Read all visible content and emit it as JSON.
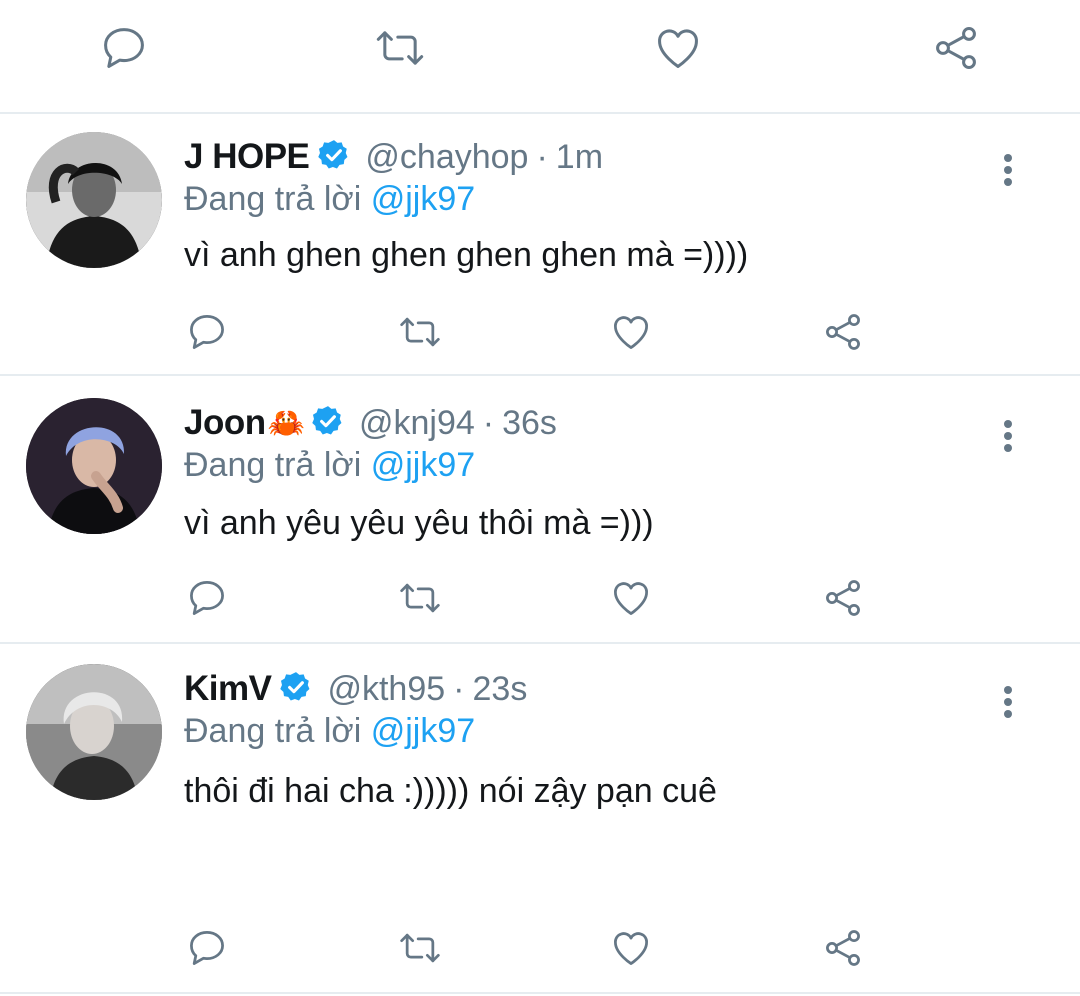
{
  "icons": {
    "reply": "reply-icon",
    "retweet": "retweet-icon",
    "like": "heart-icon",
    "share": "share-icon",
    "more": "more-vertical-icon",
    "verified": "verified-badge-icon"
  },
  "colors": {
    "text_primary": "#14171a",
    "text_secondary": "#657786",
    "link": "#1da1f2",
    "icon": "#657786",
    "divider": "#e6ecf0",
    "verified": "#1da1f2"
  },
  "tweets": [
    {
      "name": "J HOPE",
      "emoji": "",
      "handle": "@chayhop",
      "separator": "·",
      "time": "1m",
      "reply_prefix": "Đang trả lời",
      "reply_to": "@jjk97",
      "text": "vì anh ghen ghen ghen ghen mà =))))"
    },
    {
      "name": "Joon",
      "emoji": "🦀",
      "handle": "@knj94",
      "separator": "·",
      "time": "36s",
      "reply_prefix": "Đang trả lời",
      "reply_to": "@jjk97",
      "text": "vì anh yêu yêu yêu thôi mà =)))"
    },
    {
      "name": "KimV",
      "emoji": "",
      "handle": "@kth95",
      "separator": "·",
      "time": "23s",
      "reply_prefix": "Đang trả lời",
      "reply_to": "@jjk97",
      "text": "thôi đi hai cha :))))) nói zậy pạn cuê"
    }
  ]
}
